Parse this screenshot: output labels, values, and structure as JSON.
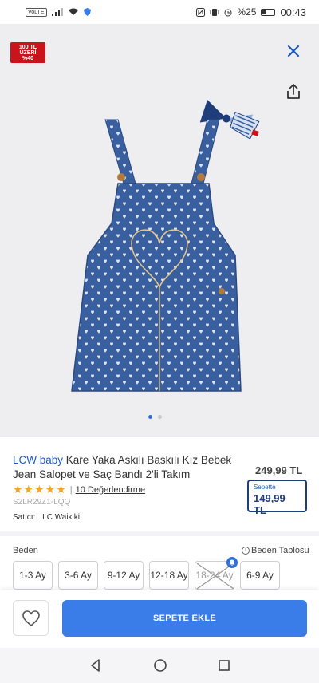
{
  "status_bar": {
    "network": "VoLTE",
    "battery": "%25",
    "time": "00:43"
  },
  "promo_badge": {
    "line1": "100 TL",
    "line2": "ÜZERİ",
    "line3": "%40"
  },
  "gallery": {
    "total_images": 2,
    "active_index": 0
  },
  "product": {
    "brand": "LCW baby",
    "title": "Kare Yaka Askılı Baskılı Kız Bebek Jean Salopet ve Saç Bandı 2'li Takım",
    "price": "249,99 TL",
    "rating_stars": 5,
    "reviews_link": "10 Değerlendirme",
    "sku": "S2LR29Z1-LQQ",
    "seller_label": "Satıcı:",
    "seller_name": "LC Waikiki",
    "cart_price_label": "Sepette",
    "cart_price": "149,99 TL"
  },
  "size": {
    "label": "Beden",
    "guide": "Beden Tablosu",
    "options": [
      {
        "label": "1-3 Ay",
        "available": true
      },
      {
        "label": "3-6 Ay",
        "available": true
      },
      {
        "label": "9-12 Ay",
        "available": true
      },
      {
        "label": "12-18 Ay",
        "available": true
      },
      {
        "label": "18-24 Ay",
        "available": false
      },
      {
        "label": "6-9 Ay",
        "available": true
      }
    ]
  },
  "actions": {
    "add_to_cart": "SEPETE EKLE"
  },
  "colors": {
    "brand_blue": "#1f5bbf",
    "button_blue": "#3b7de8",
    "promo_red": "#c9141c",
    "denim": "#3a5f9e",
    "star": "#f5a623"
  }
}
